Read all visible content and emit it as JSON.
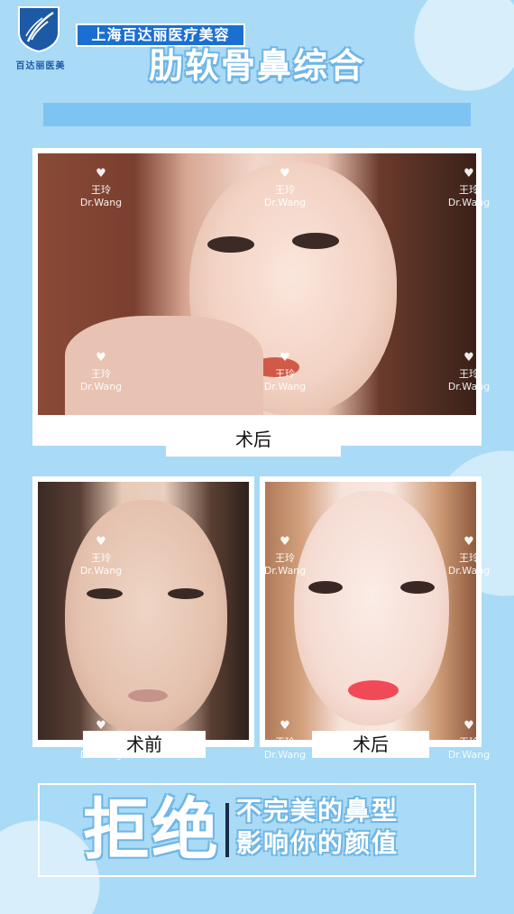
{
  "brand": {
    "logo_text": "百达丽医美",
    "clinic_name": "上海百达丽医疗美容"
  },
  "title": "肋软骨鼻综合",
  "watermark": {
    "name": "王玲",
    "sub": "Dr.Wang"
  },
  "labels": {
    "top_after": "术后",
    "before": "术前",
    "after": "术后"
  },
  "slogan": {
    "big": "拒绝",
    "line1": "不完美的鼻型",
    "line2": "影响你的颜值"
  },
  "colors": {
    "background": "#a9daf6",
    "accent": "#1b6fd1"
  }
}
